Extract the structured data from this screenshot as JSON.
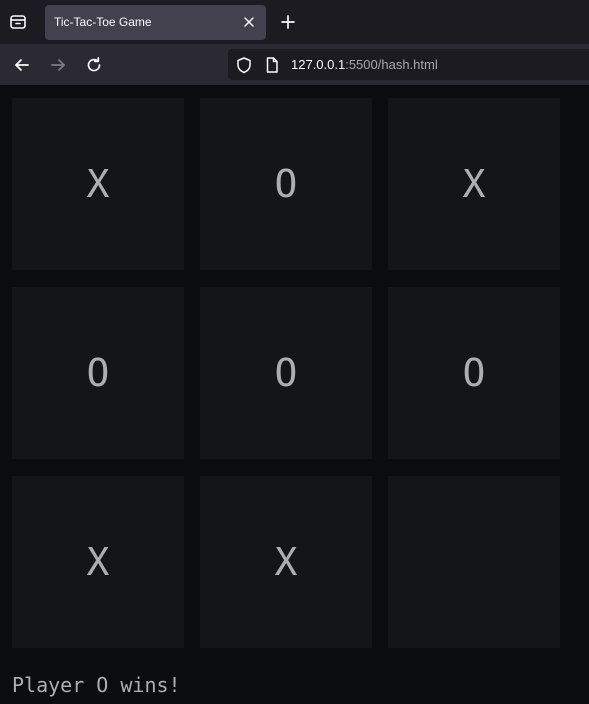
{
  "browser": {
    "tab": {
      "title": "Tic-Tac-Toe Game"
    },
    "url": {
      "host": "127.0.0.1",
      "rest": ":5500/hash.html"
    }
  },
  "game": {
    "cells": [
      "X",
      "O",
      "X",
      "O",
      "O",
      "O",
      "X",
      "X",
      ""
    ],
    "status": "Player O wins!"
  },
  "colors": {
    "page_background": "#0b0c0d",
    "cell_background": "#141516",
    "mark_text": "#aeaeae"
  }
}
